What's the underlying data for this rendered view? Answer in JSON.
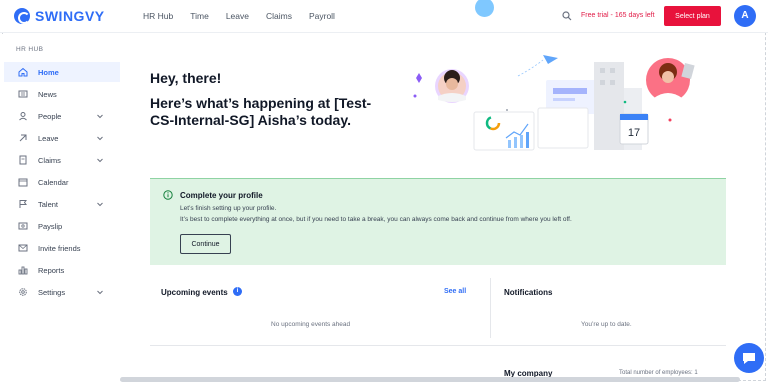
{
  "brand": {
    "name": "SWINGVY",
    "color": "#2f6df6"
  },
  "topnav": [
    "HR Hub",
    "Time",
    "Leave",
    "Claims",
    "Payroll"
  ],
  "header": {
    "trial_text": "Free trial - 165 days left",
    "select_plan_label": "Select plan",
    "avatar_initial": "A",
    "search_icon": "search-icon"
  },
  "sidebar": {
    "heading": "HR HUB",
    "items": [
      {
        "label": "Home",
        "icon": "home-icon",
        "active": true,
        "has_chevron": false
      },
      {
        "label": "News",
        "icon": "news-icon",
        "active": false,
        "has_chevron": false
      },
      {
        "label": "People",
        "icon": "people-icon",
        "active": false,
        "has_chevron": true
      },
      {
        "label": "Leave",
        "icon": "leave-icon",
        "active": false,
        "has_chevron": true
      },
      {
        "label": "Claims",
        "icon": "claims-icon",
        "active": false,
        "has_chevron": true
      },
      {
        "label": "Calendar",
        "icon": "calendar-icon",
        "active": false,
        "has_chevron": false
      },
      {
        "label": "Talent",
        "icon": "talent-icon",
        "active": false,
        "has_chevron": true
      },
      {
        "label": "Payslip",
        "icon": "payslip-icon",
        "active": false,
        "has_chevron": false
      },
      {
        "label": "Invite friends",
        "icon": "invite-icon",
        "active": false,
        "has_chevron": false
      },
      {
        "label": "Reports",
        "icon": "reports-icon",
        "active": false,
        "has_chevron": false
      },
      {
        "label": "Settings",
        "icon": "settings-icon",
        "active": false,
        "has_chevron": true
      }
    ]
  },
  "main": {
    "greeting": "Hey, there!",
    "headline": "Here’s what’s happening at [Test-CS-Internal-SG] Aisha’s today.",
    "calendar_day": "17"
  },
  "profile_card": {
    "title": "Complete your profile",
    "line1": "Let’s finish setting up your profile.",
    "line2": "It’s best to complete everything at once, but if you need to take a break, you can always come back and continue from where you left off.",
    "button_label": "Continue"
  },
  "upcoming": {
    "title": "Upcoming events",
    "info": "i",
    "see_all": "See all",
    "empty": "No upcoming events ahead"
  },
  "notifications": {
    "title": "Notifications",
    "empty": "You’re up to date."
  },
  "company": {
    "title": "My company",
    "total_employees": "Total number of employees: 1"
  },
  "colors": {
    "accent": "#2f6df6",
    "danger": "#e8123c",
    "success_bg": "#dff3e4"
  }
}
